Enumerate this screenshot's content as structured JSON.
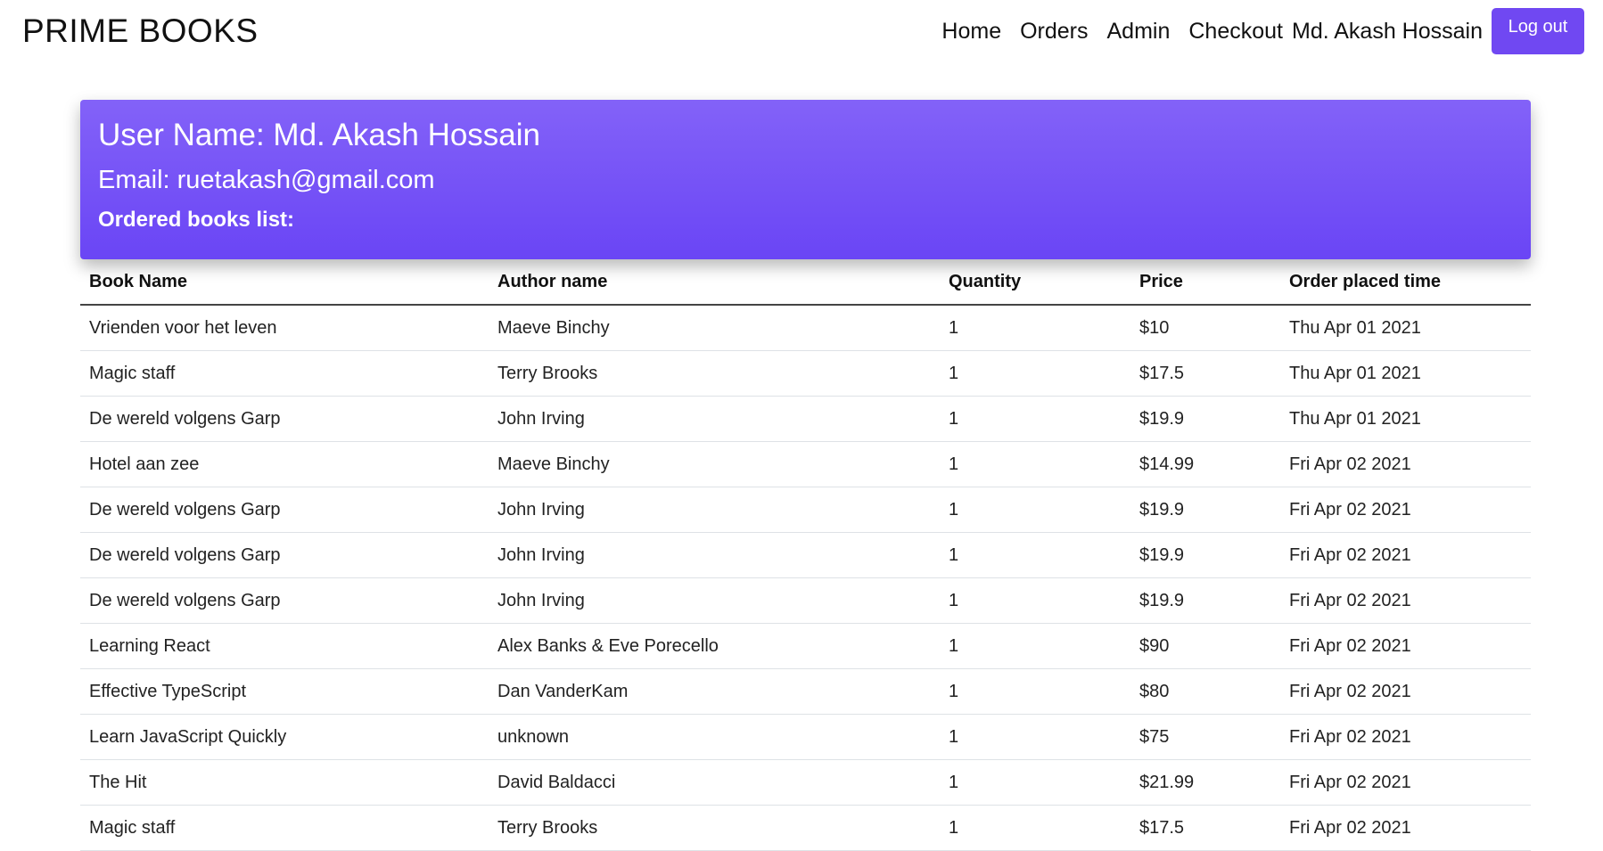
{
  "navbar": {
    "brand": "PRIME BOOKS",
    "links": [
      "Home",
      "Orders",
      "Admin",
      "Checkout"
    ],
    "user_name": "Md. Akash Hossain",
    "logout_label": "Log out"
  },
  "profile": {
    "user_name_line": "User Name: Md. Akash Hossain",
    "email_line": "Email: ruetakash@gmail.com",
    "orders_heading": "Ordered books list:"
  },
  "orders_table": {
    "headers": [
      "Book Name",
      "Author name",
      "Quantity",
      "Price",
      "Order placed time"
    ],
    "rows": [
      [
        "Vrienden voor het leven",
        "Maeve Binchy",
        "1",
        "$10",
        "Thu Apr 01 2021"
      ],
      [
        "Magic staff",
        "Terry Brooks",
        "1",
        "$17.5",
        "Thu Apr 01 2021"
      ],
      [
        "De wereld volgens Garp",
        "John Irving",
        "1",
        "$19.9",
        "Thu Apr 01 2021"
      ],
      [
        "Hotel aan zee",
        "Maeve Binchy",
        "1",
        "$14.99",
        "Fri Apr 02 2021"
      ],
      [
        "De wereld volgens Garp",
        "John Irving",
        "1",
        "$19.9",
        "Fri Apr 02 2021"
      ],
      [
        "De wereld volgens Garp",
        "John Irving",
        "1",
        "$19.9",
        "Fri Apr 02 2021"
      ],
      [
        "De wereld volgens Garp",
        "John Irving",
        "1",
        "$19.9",
        "Fri Apr 02 2021"
      ],
      [
        "Learning React",
        "Alex Banks & Eve Porecello",
        "1",
        "$90",
        "Fri Apr 02 2021"
      ],
      [
        "Effective TypeScript",
        "Dan VanderKam",
        "1",
        "$80",
        "Fri Apr 02 2021"
      ],
      [
        "Learn JavaScript Quickly",
        "unknown",
        "1",
        "$75",
        "Fri Apr 02 2021"
      ],
      [
        "The Hit",
        "David Baldacci",
        "1",
        "$21.99",
        "Fri Apr 02 2021"
      ],
      [
        "Magic staff",
        "Terry Brooks",
        "1",
        "$17.5",
        "Fri Apr 02 2021"
      ]
    ]
  },
  "colors": {
    "accent": "#7048f2",
    "card_gradient_top": "#8362f8",
    "card_gradient_bottom": "#6a45f5"
  }
}
